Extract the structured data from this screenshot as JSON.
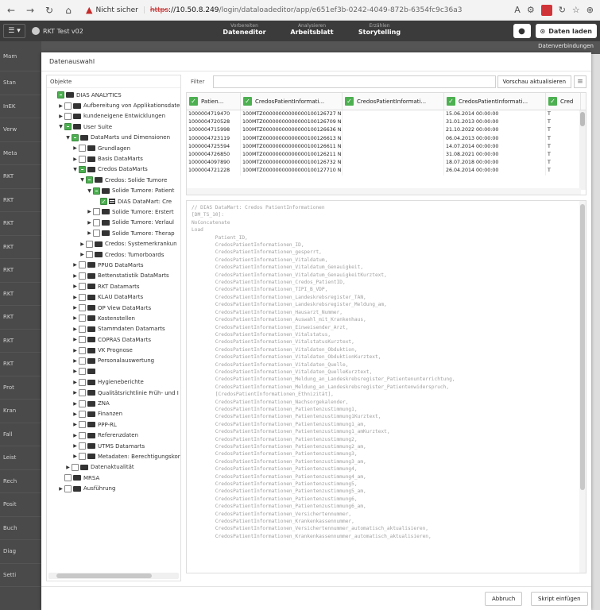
{
  "browser": {
    "not_secure": "Nicht sicher",
    "url_scheme": "https",
    "url_host": "://10.50.8.249",
    "url_path": "/login/dataloadeditor/app/e651ef3b-0242-4049-872b-6354fc9c36a3"
  },
  "header": {
    "menu_label": "☰ ▾",
    "app_name": "RKT Test v02",
    "tabs": [
      {
        "sup": "Vorbereiten",
        "main": "Dateneditor"
      },
      {
        "sup": "Analysieren",
        "main": "Arbeitsblatt"
      },
      {
        "sup": "Erzählen",
        "main": "Storytelling"
      }
    ],
    "load_button": "Daten laden"
  },
  "background": {
    "left_items": [
      "Mam",
      "Stan",
      "InEK",
      "Verw",
      "Meta",
      "RKT",
      "RKT",
      "RKT",
      "RKT",
      "RKT",
      "RKT",
      "RKT",
      "RKT",
      "RKT",
      "Prot",
      "Kran",
      "Fall",
      "Leist",
      "Rech",
      "Posit",
      "Buch",
      "Diag",
      "Setti"
    ],
    "top_right": "Datenverbindungen"
  },
  "dialog": {
    "title": "Datenauswahl",
    "objects_label": "Objekte",
    "filter_label": "Filter",
    "preview_button": "Vorschau aktualisieren",
    "cancel_button": "Abbruch",
    "insert_button": "Skript einfügen"
  },
  "tree": [
    {
      "indent": 0,
      "caret": "",
      "cb": "partial",
      "icon": "folder",
      "label": "DIAS ANALYTICS"
    },
    {
      "indent": 1,
      "caret": "▶",
      "cb": "",
      "icon": "folder",
      "label": "Aufbereitung von Applikationsdaten"
    },
    {
      "indent": 1,
      "caret": "▶",
      "cb": "",
      "icon": "folder",
      "label": "kundeneigene Entwicklungen"
    },
    {
      "indent": 1,
      "caret": "▼",
      "cb": "partial",
      "icon": "folder",
      "label": "User Suite"
    },
    {
      "indent": 2,
      "caret": "▼",
      "cb": "partial",
      "icon": "folder",
      "label": "DataMarts und Dimensionen"
    },
    {
      "indent": 3,
      "caret": "▶",
      "cb": "",
      "icon": "folder",
      "label": "Grundlagen"
    },
    {
      "indent": 3,
      "caret": "▶",
      "cb": "",
      "icon": "folder",
      "label": "Basis DataMarts"
    },
    {
      "indent": 3,
      "caret": "▼",
      "cb": "partial",
      "icon": "folder",
      "label": "Credos DataMarts"
    },
    {
      "indent": 4,
      "caret": "▼",
      "cb": "partial",
      "icon": "folder",
      "label": "Credos: Solide Tumore"
    },
    {
      "indent": 5,
      "caret": "▼",
      "cb": "partial",
      "icon": "folder",
      "label": "Solide Tumore: Patient"
    },
    {
      "indent": 6,
      "caret": "",
      "cb": "checked",
      "icon": "table",
      "label": "DIAS DataMart: Cre"
    },
    {
      "indent": 5,
      "caret": "▶",
      "cb": "",
      "icon": "folder",
      "label": "Solide Tumore: Erstert"
    },
    {
      "indent": 5,
      "caret": "▶",
      "cb": "",
      "icon": "folder",
      "label": "Solide Tumore: Verlaul"
    },
    {
      "indent": 5,
      "caret": "▶",
      "cb": "",
      "icon": "folder",
      "label": "Solide Tumore: Therap"
    },
    {
      "indent": 4,
      "caret": "▶",
      "cb": "",
      "icon": "folder",
      "label": "Credos: Systemerkrankun"
    },
    {
      "indent": 4,
      "caret": "▶",
      "cb": "",
      "icon": "folder",
      "label": "Credos: Tumorboards"
    },
    {
      "indent": 3,
      "caret": "▶",
      "cb": "",
      "icon": "folder",
      "label": "PPUG DataMarts"
    },
    {
      "indent": 3,
      "caret": "▶",
      "cb": "",
      "icon": "folder",
      "label": "Bettenstatistik DataMarts"
    },
    {
      "indent": 3,
      "caret": "▶",
      "cb": "",
      "icon": "folder",
      "label": "RKT Datamarts"
    },
    {
      "indent": 3,
      "caret": "▶",
      "cb": "",
      "icon": "folder",
      "label": "KLAU DataMarts"
    },
    {
      "indent": 3,
      "caret": "▶",
      "cb": "",
      "icon": "folder",
      "label": "OP View DataMarts"
    },
    {
      "indent": 3,
      "caret": "▶",
      "cb": "",
      "icon": "folder",
      "label": "Kostenstellen"
    },
    {
      "indent": 3,
      "caret": "▶",
      "cb": "",
      "icon": "folder",
      "label": "Stammdaten Datamarts"
    },
    {
      "indent": 3,
      "caret": "▶",
      "cb": "",
      "icon": "folder",
      "label": "COPRAS DataMarts"
    },
    {
      "indent": 3,
      "caret": "▶",
      "cb": "",
      "icon": "folder",
      "label": "VK Prognose"
    },
    {
      "indent": 3,
      "caret": "▶",
      "cb": "",
      "icon": "folder",
      "label": "Personalauswertung"
    },
    {
      "indent": 3,
      "caret": "▶",
      "cb": "",
      "icon": "folder",
      "label": ""
    },
    {
      "indent": 3,
      "caret": "▶",
      "cb": "",
      "icon": "folder",
      "label": "Hygieneberichte"
    },
    {
      "indent": 3,
      "caret": "▶",
      "cb": "",
      "icon": "folder",
      "label": "Qualitätsrichtlinie Früh- und I"
    },
    {
      "indent": 3,
      "caret": "▶",
      "cb": "",
      "icon": "folder",
      "label": "ZNA"
    },
    {
      "indent": 3,
      "caret": "▶",
      "cb": "",
      "icon": "folder",
      "label": "Finanzen"
    },
    {
      "indent": 3,
      "caret": "▶",
      "cb": "",
      "icon": "folder",
      "label": "PPP-RL"
    },
    {
      "indent": 3,
      "caret": "▶",
      "cb": "",
      "icon": "folder",
      "label": "Referenzdaten"
    },
    {
      "indent": 3,
      "caret": "▶",
      "cb": "",
      "icon": "folder",
      "label": "UTMS Datamarts"
    },
    {
      "indent": 3,
      "caret": "▶",
      "cb": "",
      "icon": "folder",
      "label": "Metadaten: Berechtigungskor"
    },
    {
      "indent": 2,
      "caret": "▶",
      "cb": "",
      "icon": "folder",
      "label": "Datenaktualität"
    },
    {
      "indent": 1,
      "caret": "",
      "cb": "",
      "icon": "folder",
      "label": "MRSA"
    },
    {
      "indent": 1,
      "caret": "▶",
      "cb": "",
      "icon": "folder",
      "label": "Ausführung"
    }
  ],
  "grid": {
    "columns": [
      "Patien...",
      "CredosPatientInformati...",
      "CredosPatientInformati...",
      "CredosPatientInformati...",
      "Cred"
    ],
    "rows": [
      [
        "1000004719470",
        "100MTZ00000000000000100126727 N",
        "",
        "15.06.2014 00:00:00",
        "T"
      ],
      [
        "1000004720528",
        "100MTZ00000000000000100126709 N",
        "",
        "31.01.2013 00:00:00",
        "T"
      ],
      [
        "1000004715998",
        "100MTZ00000000000000100126636 N",
        "",
        "21.10.2022 00:00:00",
        "T"
      ],
      [
        "1000004723119",
        "100MTZ00000000000000100126613 N",
        "",
        "06.04.2013 00:00:00",
        "T"
      ],
      [
        "1000004725594",
        "100MTZ00000000000000100126611 N",
        "",
        "14.07.2014 00:00:00",
        "T"
      ],
      [
        "1000004726850",
        "100MTZ00000000000000100126211 N",
        "",
        "31.08.2021 00:00:00",
        "T"
      ],
      [
        "1000004097890",
        "100MTZ00000000000000100126732 N",
        "",
        "18.07.2018 00:00:00",
        "T"
      ],
      [
        "1000004721228",
        "100MTZ00000000000000100127710 N",
        "",
        "26.04.2014 00:00:00",
        "T"
      ]
    ]
  },
  "script_lines": [
    "// DIAS DataMart: Credos PatientInformationen",
    "[DM_TS_10]:",
    "NoConcatenate",
    "Load",
    "        Patient_ID,",
    "        CredosPatientInformationen_ID,",
    "        CredosPatientInformationen_gesperrt,",
    "        CredosPatientInformationen_Vitaldatum,",
    "        CredosPatientInformationen_Vitaldatum_Genauigkeit,",
    "        CredosPatientInformationen_Vitaldatum_GenauigkeitKurztext,",
    "        CredosPatientInformationen_Credos_PatientID,",
    "        CredosPatientInformationen_TIPI_B_VDP,",
    "        CredosPatientInformationen_Landeskrebsregister_TAN,",
    "        CredosPatientInformationen_Landeskrebsregister_Meldung_am,",
    "        CredosPatientInformationen_Hausarzt_Nummer,",
    "        CredosPatientInformationen_Auswahl_mit_Krankenhaus,",
    "        CredosPatientInformationen_Einweisender_Arzt,",
    "        CredosPatientInformationen_Vitalstatus,",
    "        CredosPatientInformationen_VitalstatusKurztext,",
    "        CredosPatientInformationen_Vitaldaten_Obduktion,",
    "        CredosPatientInformationen_Vitaldaten_ObduktionKurztext,",
    "        CredosPatientInformationen_Vitaldaten_Quelle,",
    "        CredosPatientInformationen_Vitaldaten_QuelleKurztext,",
    "        CredosPatientInformationen_Meldung_an_Landeskrebsregister_Patientenunterrichtung,",
    "        CredosPatientInformationen_Meldung_an_Landeskrebsregister_Patientenwiderspruch,",
    "        [CredosPatientInformationen_Ethnizität],",
    "        CredosPatientInformationen_Nachsorgekalender,",
    "        CredosPatientInformationen_Patientenzustimmung1,",
    "        CredosPatientInformationen_Patientenzustimmung1Kurztext,",
    "        CredosPatientInformationen_Patientenzustimmung1_am,",
    "        CredosPatientInformationen_Patientenzustimmung1_amKurztext,",
    "        CredosPatientInformationen_Patientenzustimmung2,",
    "        CredosPatientInformationen_Patientenzustimmung2_am,",
    "        CredosPatientInformationen_Patientenzustimmung3,",
    "        CredosPatientInformationen_Patientenzustimmung3_am,",
    "        CredosPatientInformationen_Patientenzustimmung4,",
    "        CredosPatientInformationen_Patientenzustimmung4_am,",
    "        CredosPatientInformationen_Patientenzustimmung5,",
    "        CredosPatientInformationen_Patientenzustimmung5_am,",
    "        CredosPatientInformationen_Patientenzustimmung6,",
    "        CredosPatientInformationen_Patientenzustimmung6_am,",
    "        CredosPatientInformationen_Versichertennummer,",
    "        CredosPatientInformationen_Krankenkassennummer,",
    "        CredosPatientInformationen_Versichertennummer_automatisch_aktualisieren,",
    "        CredosPatientInformationen_Krankenkassennummer_automatisch_aktualisieren,"
  ]
}
